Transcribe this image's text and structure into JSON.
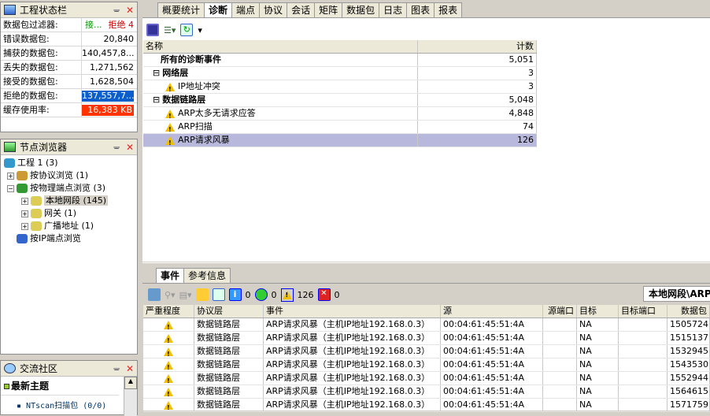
{
  "status_panel": {
    "title": "工程状态栏",
    "rows": [
      {
        "label": "数据包过滤器:",
        "value": "接...",
        "value2": "拒绝 4"
      },
      {
        "label": "错误数据包:",
        "value": "20,840"
      },
      {
        "label": "捕获的数据包:",
        "value": "140,457,8..."
      },
      {
        "label": "丢失的数据包:",
        "value": "1,271,562"
      },
      {
        "label": "接受的数据包:",
        "value": "1,628,504"
      },
      {
        "label": "拒绝的数据包:",
        "value": "137,557,7...",
        "bg": "#0a5fcc"
      },
      {
        "label": "缓存使用率:",
        "value": "16,383 KB",
        "bg": "#ff3300"
      }
    ]
  },
  "node_panel": {
    "title": "节点浏览器",
    "items": [
      {
        "label": "工程 1 (3)",
        "level": 0,
        "expander": ""
      },
      {
        "label": "按协议浏览 (1)",
        "level": 1,
        "expander": "+"
      },
      {
        "label": "按物理端点浏览 (3)",
        "level": 1,
        "expander": "-"
      },
      {
        "label": "本地网段 (145)",
        "level": 2,
        "expander": "+",
        "selected": true
      },
      {
        "label": "网关 (1)",
        "level": 2,
        "expander": "+"
      },
      {
        "label": "广播地址 (1)",
        "level": 2,
        "expander": "+"
      },
      {
        "label": "按IP端点浏览",
        "level": 1,
        "expander": ""
      }
    ]
  },
  "community_panel": {
    "title": "交流社区",
    "heading": "最新主题",
    "items": [
      "NTscan扫描包 (0/0)"
    ]
  },
  "main_tabs": [
    {
      "label": "概要统计"
    },
    {
      "label": "诊断",
      "active": true
    },
    {
      "label": "端点"
    },
    {
      "label": "协议"
    },
    {
      "label": "会话"
    },
    {
      "label": "矩阵"
    },
    {
      "label": "数据包"
    },
    {
      "label": "日志"
    },
    {
      "label": "图表"
    },
    {
      "label": "报表"
    }
  ],
  "diag_table": {
    "columns": [
      "名称",
      "计数"
    ],
    "rows": [
      {
        "name": "所有的诊断事件",
        "count": "5,051",
        "level": 0,
        "bold": true
      },
      {
        "name": "网络层",
        "count": "3",
        "level": 0,
        "bold": true,
        "expander": "-"
      },
      {
        "name": "IP地址冲突",
        "count": "3",
        "level": 1,
        "icon": "warning"
      },
      {
        "name": "数据链路层",
        "count": "5,048",
        "level": 0,
        "bold": true,
        "expander": "-"
      },
      {
        "name": "ARP太多无请求应答",
        "count": "4,848",
        "level": 1,
        "icon": "warning"
      },
      {
        "name": "ARP扫描",
        "count": "74",
        "level": 1,
        "icon": "warning"
      },
      {
        "name": "ARP请求风暴",
        "count": "126",
        "level": 1,
        "icon": "warning",
        "selected": true
      }
    ]
  },
  "bottom_tabs": [
    {
      "label": "事件",
      "active": true
    },
    {
      "label": "参考信息"
    }
  ],
  "event_counts": {
    "info": "0",
    "ok": "0",
    "warning": "126",
    "error": "0"
  },
  "path_label": "本地网段\\ARP",
  "events": {
    "columns": [
      "严重程度",
      "协议层",
      "事件",
      "源",
      "源端口",
      "目标",
      "目标端口",
      "数据包"
    ],
    "rows": [
      [
        "",
        "数据链路层",
        "ARP请求风暴（主机IP地址192.168.0.3）",
        "00:04:61:45:51:4A",
        "",
        "NA",
        "",
        "1505724"
      ],
      [
        "",
        "数据链路层",
        "ARP请求风暴（主机IP地址192.168.0.3）",
        "00:04:61:45:51:4A",
        "",
        "NA",
        "",
        "1515137"
      ],
      [
        "",
        "数据链路层",
        "ARP请求风暴（主机IP地址192.168.0.3）",
        "00:04:61:45:51:4A",
        "",
        "NA",
        "",
        "1532945"
      ],
      [
        "",
        "数据链路层",
        "ARP请求风暴（主机IP地址192.168.0.3）",
        "00:04:61:45:51:4A",
        "",
        "NA",
        "",
        "1543530"
      ],
      [
        "",
        "数据链路层",
        "ARP请求风暴（主机IP地址192.168.0.3）",
        "00:04:61:45:51:4A",
        "",
        "NA",
        "",
        "1552944"
      ],
      [
        "",
        "数据链路层",
        "ARP请求风暴（主机IP地址192.168.0.3）",
        "00:04:61:45:51:4A",
        "",
        "NA",
        "",
        "1564615"
      ],
      [
        "",
        "数据链路层",
        "ARP请求风暴（主机IP地址192.168.0.3）",
        "00:04:61:45:51:4A",
        "",
        "NA",
        "",
        "1571759"
      ]
    ]
  }
}
